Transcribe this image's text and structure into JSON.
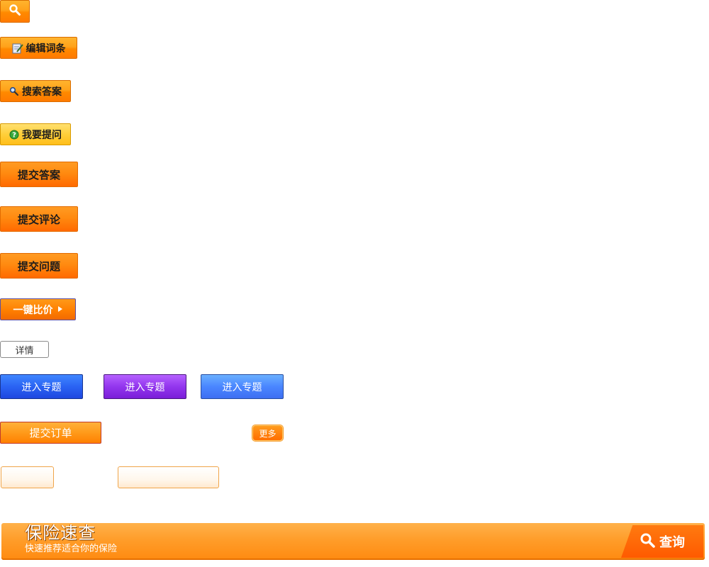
{
  "buttons": {
    "edit_entry": "编辑词条",
    "search_answer": "搜索答案",
    "ask_question": "我要提问",
    "submit_answer": "提交答案",
    "submit_comment": "提交评论",
    "submit_question": "提交问题",
    "compare_price": "一键比价",
    "details": "详情",
    "enter_topic": [
      "进入专题",
      "进入专题",
      "进入专题"
    ],
    "submit_order": "提交订单",
    "more": "更多"
  },
  "icons": {
    "search": "search-icon",
    "edit": "edit-icon",
    "question": "question-icon",
    "arrow": "play-arrow-icon"
  },
  "banner": {
    "title": "保险速查",
    "subtitle": "快速推荐适合你的保险",
    "query_label": "查询"
  },
  "colors": {
    "orange": "#ff8a00",
    "yellow": "#ffcf3a",
    "blue": "#2a63f3",
    "purple": "#9336ee",
    "light_blue": "#4a86ff"
  }
}
